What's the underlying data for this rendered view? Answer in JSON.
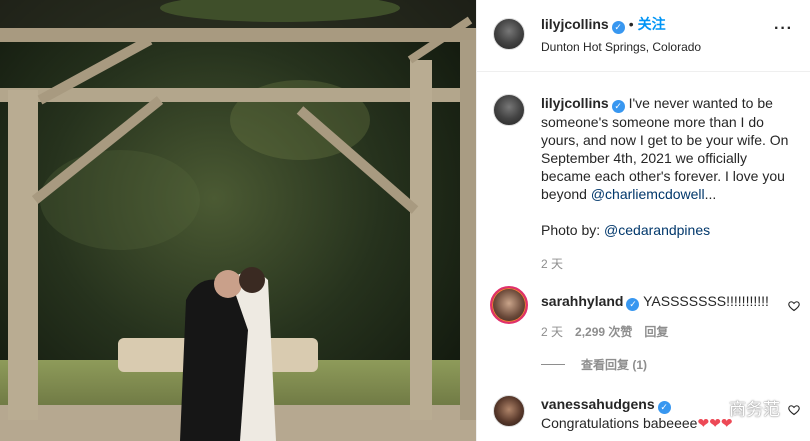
{
  "header": {
    "username": "lilyjcollins",
    "follow_label": "关注",
    "dot": "•",
    "location": "Dunton Hot Springs, Colorado",
    "more_label": "···"
  },
  "caption": {
    "username": "lilyjcollins",
    "text_before": " I've never wanted to be someone's someone more than I do yours, and now I get to be your wife. On September 4th, 2021 we officially became each other's forever. I love you beyond ",
    "mention": "@charliemcdowell",
    "ellipsis": "...",
    "photo_by_label": "Photo by: ",
    "photo_by_mention": "@cedarandpines",
    "time": "2 天"
  },
  "comments": [
    {
      "username": "sarahhyland",
      "text": " YASSSSSSS!!!!!!!!!!!",
      "time": "2 天",
      "likes": "2,299 次赞",
      "reply_label": "回复"
    },
    {
      "username": "vanessahudgens",
      "text": "Congratulations babeeee",
      "hearts": "❤❤❤"
    }
  ],
  "view_replies_label": "查看回复 (1)",
  "watermark": "商务范",
  "icons": {
    "verified": "✓",
    "heart": "heart-outline-icon"
  },
  "colors": {
    "link_blue": "#0095f6",
    "mention": "#00376b",
    "verified_blue": "#3897f0",
    "secondary_text": "#8e8e8e",
    "heart_red": "#ed4956"
  }
}
